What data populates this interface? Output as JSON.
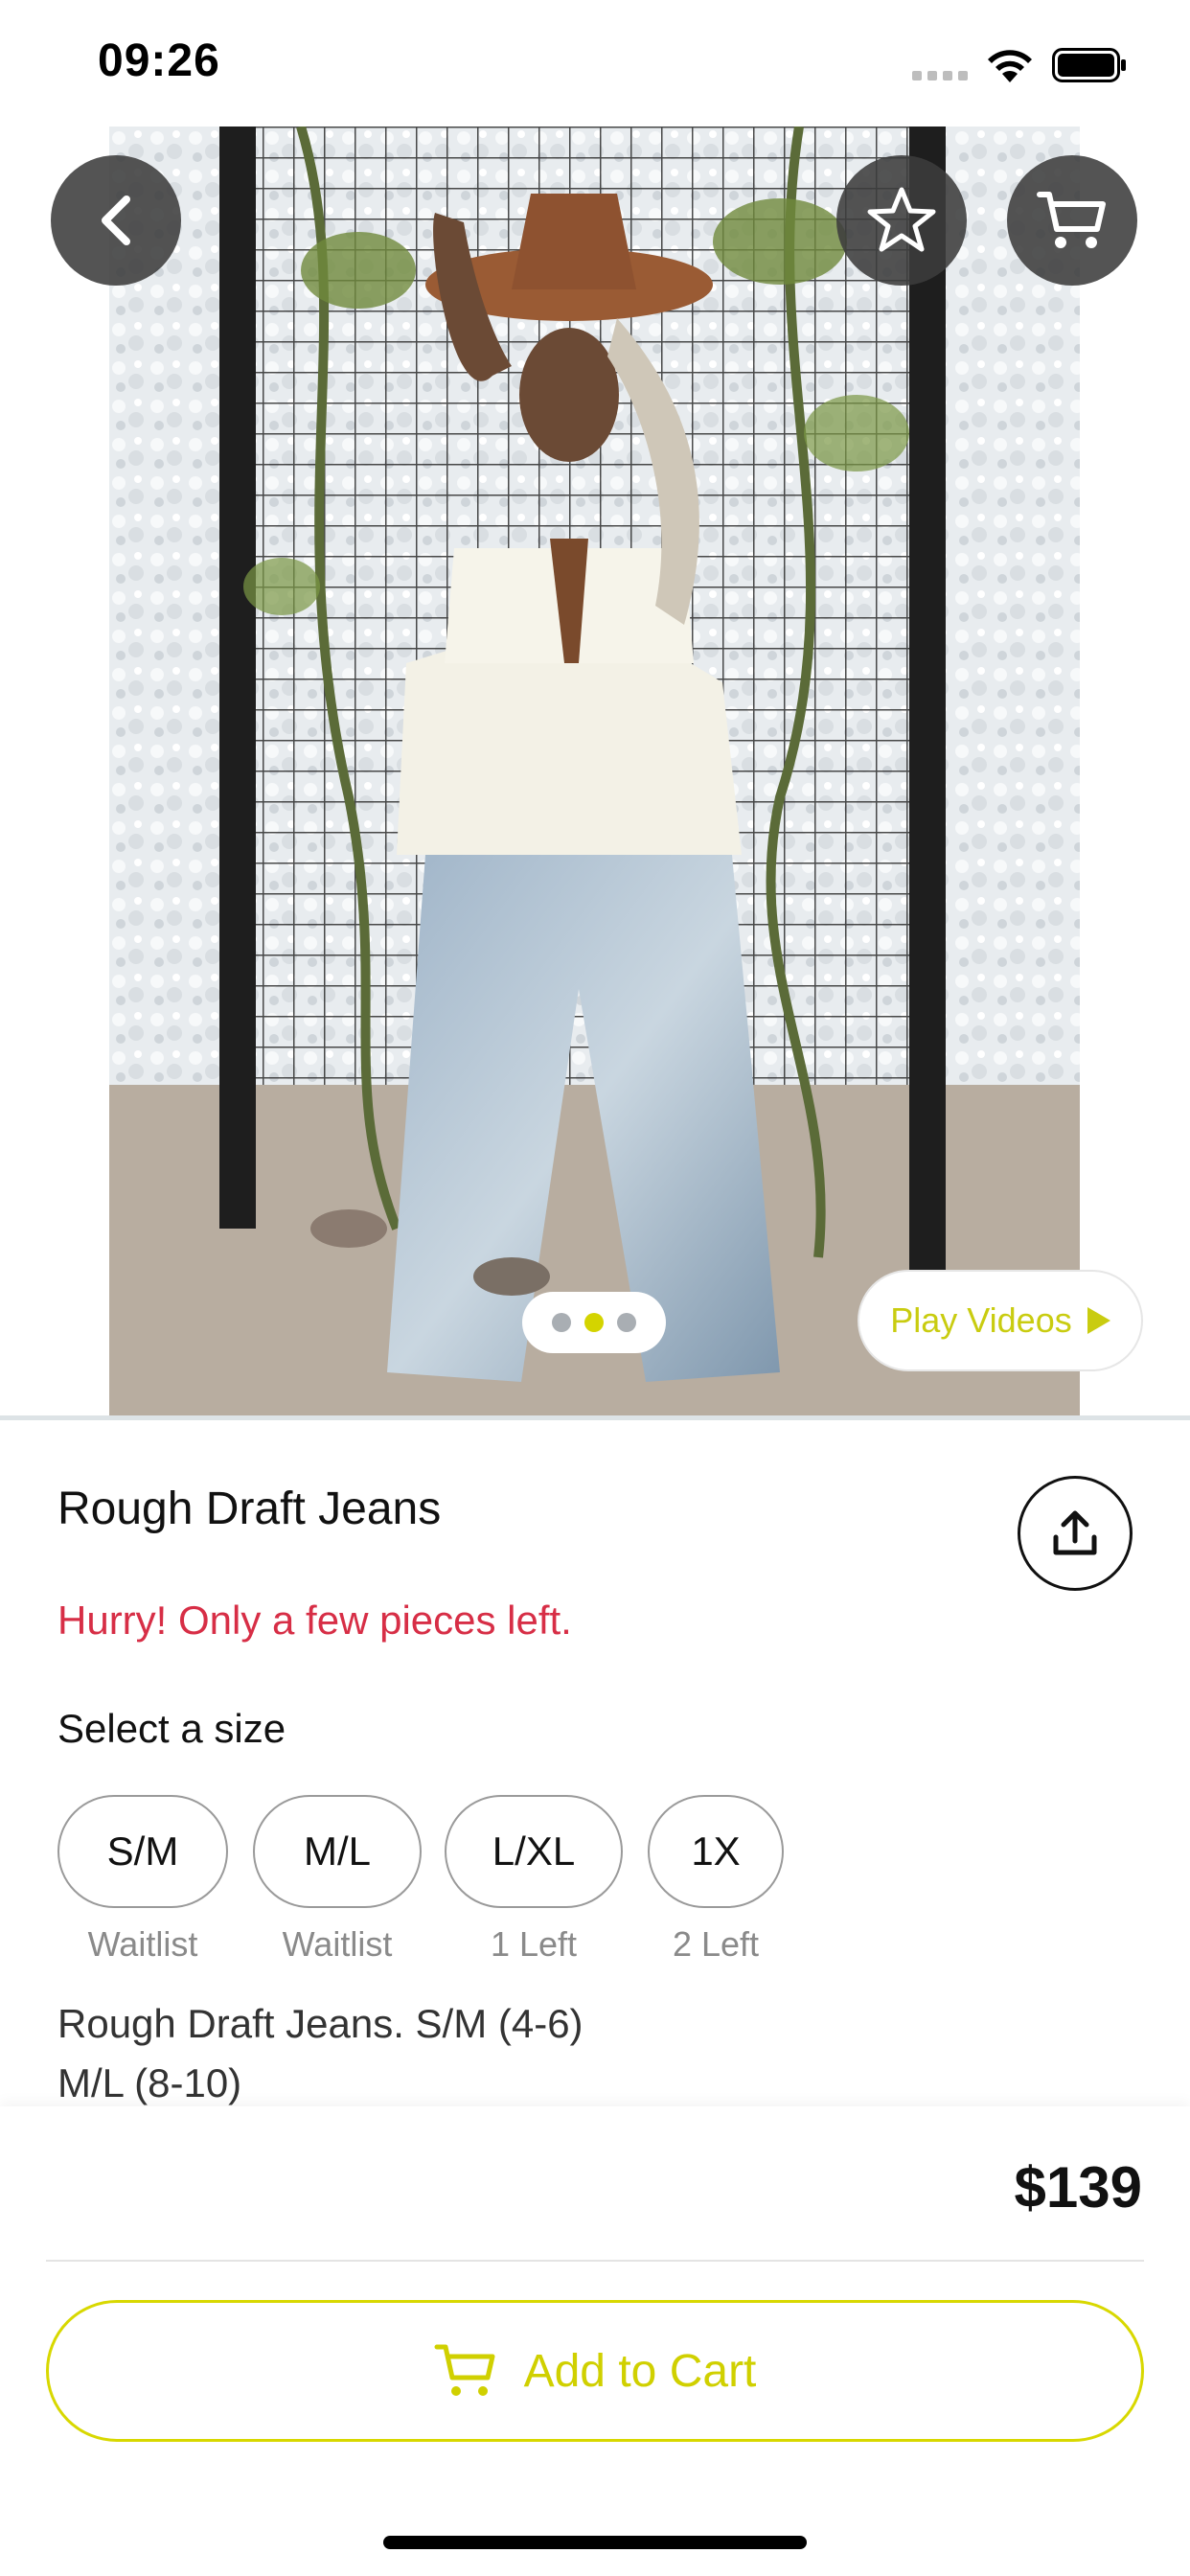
{
  "status_bar": {
    "time": "09:26"
  },
  "product": {
    "title": "Rough Draft Jeans",
    "stock_warning": "Hurry! Only a few pieces left.",
    "size_heading": "Select a size",
    "sizes": [
      {
        "label": "S/M",
        "availability": "Waitlist"
      },
      {
        "label": "M/L",
        "availability": "Waitlist"
      },
      {
        "label": "L/XL",
        "availability": "1 Left"
      },
      {
        "label": "1X",
        "availability": "2 Left"
      }
    ],
    "description_lines": [
      "Rough Draft Jeans. S/M (4-6)",
      "M/L (8-10)"
    ],
    "price": "$139"
  },
  "gallery": {
    "play_videos_label": "Play Videos",
    "image_count": 3,
    "active_index": 1
  },
  "actions": {
    "add_to_cart_label": "Add to Cart"
  },
  "colors": {
    "accent": "#d4d400",
    "warning": "#d72e46"
  },
  "icons": [
    "back-arrow-icon",
    "star-icon",
    "cart-icon",
    "share-icon",
    "play-icon"
  ]
}
